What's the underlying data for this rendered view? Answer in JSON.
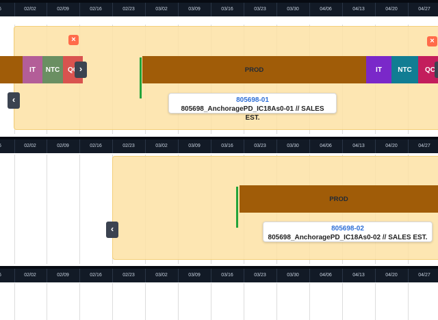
{
  "timeline": {
    "dates": [
      "6",
      "02/02",
      "02/09",
      "02/16",
      "02/23",
      "03/02",
      "03/09",
      "03/16",
      "03/23",
      "03/30",
      "04/06",
      "04/13",
      "04/20",
      "04/27"
    ]
  },
  "rows": [
    {
      "close_label": "×",
      "close_right_label": "×",
      "bars": [
        {
          "label": "",
          "color": "#a05c08"
        },
        {
          "label": "IT",
          "color": "#b35e98"
        },
        {
          "label": "NTC",
          "color": "#6a8f62"
        },
        {
          "label": "QC",
          "color": "#d9534f"
        },
        {
          "label": "PROD",
          "color": "#a05c08"
        },
        {
          "label": "IT",
          "color": "#7a28c9"
        },
        {
          "label": "NTC",
          "color": "#117d93"
        },
        {
          "label": "QC",
          "color": "#c31d5c"
        }
      ],
      "nav_left": "‹",
      "nav_right": "›",
      "tooltip": {
        "id": "805698-01",
        "name": "805698_AnchoragePD_IC18As0-01 // SALES EST."
      }
    },
    {
      "bars": [
        {
          "label": "PROD",
          "color": "#a05c08"
        }
      ],
      "nav_left": "‹",
      "tooltip": {
        "id": "805698-02",
        "name": "805698_AnchoragePD_IC18As0-02 // SALES EST."
      }
    }
  ]
}
